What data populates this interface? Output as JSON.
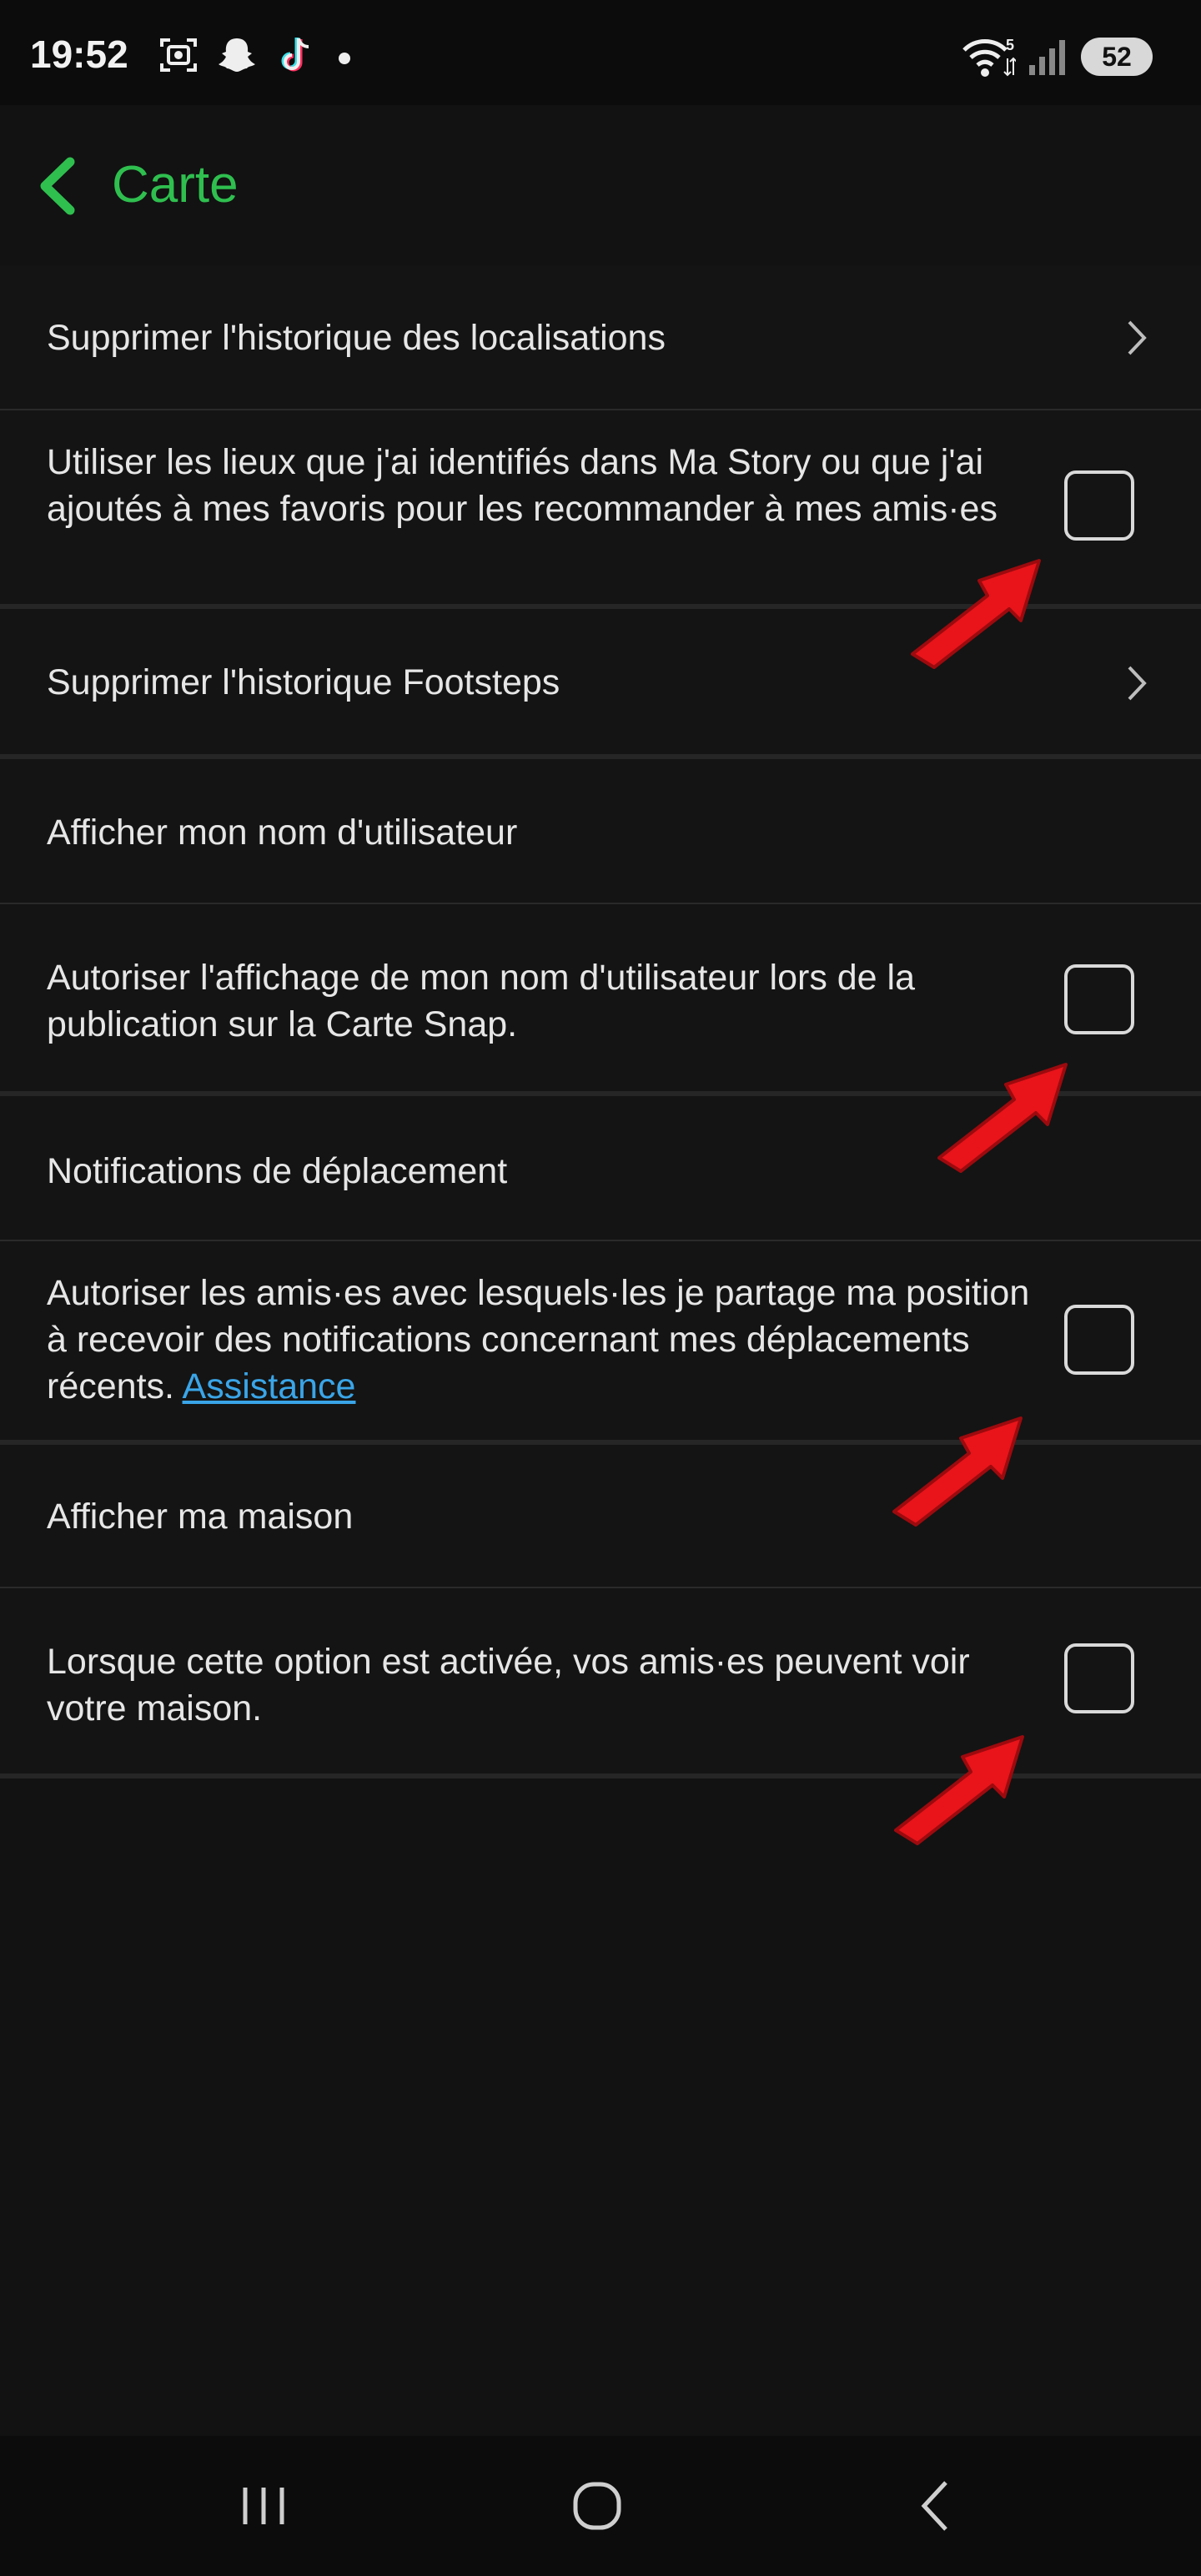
{
  "status_bar": {
    "time": "19:52",
    "left_icons": [
      "screenshot-icon",
      "snapchat-icon",
      "tiktok-icon",
      "dot-icon"
    ],
    "right_icons": [
      "wifi-icon",
      "signal-icon"
    ],
    "wifi_label": "5",
    "battery": "52"
  },
  "header": {
    "title": "Carte",
    "accent_color": "#2fbf4f"
  },
  "settings": {
    "delete_location_history": "Supprimer l'historique des localisations",
    "use_places": {
      "label": "Utiliser les lieux que j'ai identifiés dans Ma Story ou que j'ai ajoutés à mes favoris pour les recommander à mes amis·es",
      "checked": false
    },
    "delete_footsteps": "Supprimer l'historique Footsteps",
    "show_username_section": "Afficher mon nom d'utilisateur",
    "show_username": {
      "label": "Autoriser l'affichage de mon nom d'utilisateur lors de la publication sur la Carte Snap.",
      "checked": false
    },
    "movement_notifications_section": "Notifications de déplacement",
    "movement_notifications": {
      "label": "Autoriser les amis·es avec lesquels·les je partage ma position à recevoir des notifications concernant mes déplacements récents.",
      "link": "Assistance",
      "checked": false
    },
    "show_home_section": "Afficher ma maison",
    "show_home": {
      "label": "Lorsque cette option est activée, vos amis·es peuvent voir votre maison.",
      "checked": false
    }
  },
  "annotations": {
    "arrow_color": "#e8141a"
  },
  "nav_bar": {
    "buttons": [
      "recents-icon",
      "home-icon",
      "back-icon"
    ]
  }
}
